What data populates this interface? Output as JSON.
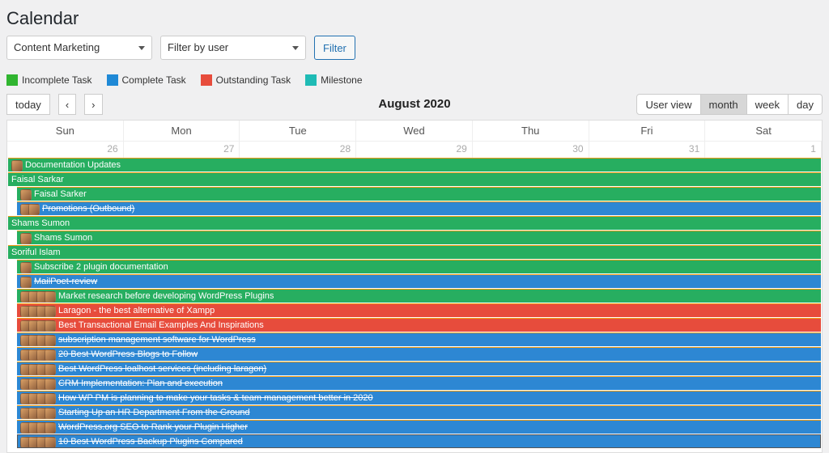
{
  "page": {
    "title": "Calendar"
  },
  "filters": {
    "project_select": "Content Marketing",
    "user_select_placeholder": "Filter by user",
    "filter_button": "Filter"
  },
  "legend": {
    "incomplete": "Incomplete Task",
    "complete": "Complete Task",
    "outstanding": "Outstanding Task",
    "milestone": "Milestone"
  },
  "toolbar": {
    "today": "today",
    "prev_glyph": "‹",
    "next_glyph": "›",
    "period_label": "August 2020",
    "views": {
      "user": "User view",
      "month": "month",
      "week": "week",
      "day": "day"
    }
  },
  "calendar": {
    "day_headers": [
      "Sun",
      "Mon",
      "Tue",
      "Wed",
      "Thu",
      "Fri",
      "Sat"
    ],
    "dates_row1": [
      "26",
      "27",
      "28",
      "29",
      "30",
      "31",
      "1"
    ]
  },
  "events": [
    {
      "color": "green",
      "avatars": 1,
      "label": "Documentation Updates"
    },
    {
      "color": "green",
      "avatars": 0,
      "label": "Faisal Sarkar"
    },
    {
      "color": "green",
      "avatars": 1,
      "label": "Faisal Sarker",
      "indent": true
    },
    {
      "color": "blue",
      "avatars": 2,
      "label": "Promotions (Outbound)",
      "strike": true,
      "indent": true
    },
    {
      "color": "green",
      "avatars": 0,
      "label": "Shams Sumon"
    },
    {
      "color": "green",
      "avatars": 1,
      "label": "Shams Sumon",
      "indent": true
    },
    {
      "color": "green",
      "avatars": 0,
      "label": "Soriful Islam"
    },
    {
      "color": "green",
      "avatars": 1,
      "label": "Subscribe 2 plugin documentation",
      "indent": true
    },
    {
      "color": "blue",
      "avatars": 1,
      "label": "MailPoet-review",
      "strike": true,
      "indent": true
    },
    {
      "color": "green",
      "avatars": 4,
      "label": "Market research before developing WordPress Plugins",
      "indent": true
    },
    {
      "color": "red",
      "avatars": 4,
      "label": "Laragon - the best alternative of Xampp",
      "indent": true
    },
    {
      "color": "red",
      "avatars": 4,
      "label": "Best Transactional Email Examples And Inspirations",
      "indent": true
    },
    {
      "color": "blue",
      "avatars": 4,
      "label": "subscription management software for WordPress",
      "strike": true,
      "indent": true
    },
    {
      "color": "blue",
      "avatars": 4,
      "label": "20 Best WordPress Blogs to Follow",
      "strike": true,
      "indent": true
    },
    {
      "color": "blue",
      "avatars": 4,
      "label": "Best WordPress loalhost services (including laragon)",
      "strike": true,
      "indent": true
    },
    {
      "color": "blue",
      "avatars": 4,
      "label": "CRM Implementation: Plan and execution",
      "strike": true,
      "indent": true
    },
    {
      "color": "blue",
      "avatars": 4,
      "label": "How WP PM is planning to make your tasks & team management better in 2020",
      "strike": true,
      "indent": true
    },
    {
      "color": "blue",
      "avatars": 4,
      "label": "Starting Up an HR Department From the Ground",
      "strike": true,
      "indent": true
    },
    {
      "color": "blue",
      "avatars": 4,
      "label": "WordPress.org SEO to Rank your Plugin Higher",
      "strike": true,
      "indent": true
    },
    {
      "color": "blue",
      "avatars": 4,
      "label": "10 Best WordPress Backup Plugins Compared",
      "strike": true,
      "indent": true,
      "edge": true
    }
  ]
}
